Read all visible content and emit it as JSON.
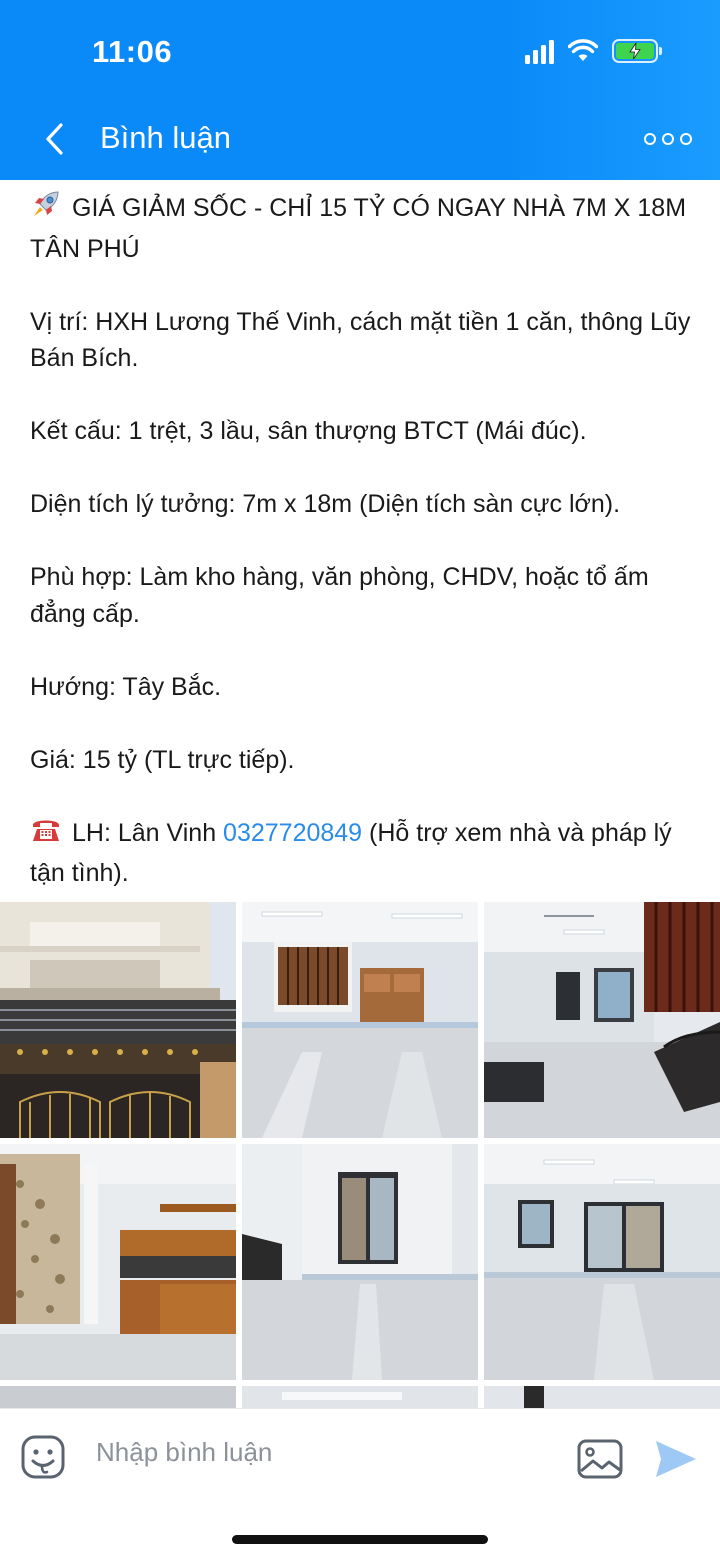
{
  "status_bar": {
    "time": "11:06"
  },
  "header": {
    "title": "Bình luận",
    "back_icon": "chevron-left-icon",
    "more_icon": "more-icon"
  },
  "post": {
    "headline": "GIÁ GIẢM SỐC - CHỈ 15 TỶ CÓ NGAY NHÀ 7M X 18M TÂN PHÚ",
    "headline_emoji": "rocket-icon",
    "location": "Vị trí: HXH Lương Thế Vinh, cách mặt tiền 1 căn, thông Lũy Bán Bích.",
    "structure": "Kết cấu: 1 trệt, 3 lầu, sân thượng BTCT (Mái đúc).",
    "area": "Diện tích lý tưởng: 7m x 18m (Diện tích sàn cực lớn).",
    "suitable": "Phù hợp: Làm kho hàng, văn phòng, CHDV, hoặc tổ ấm đẳng cấp.",
    "direction": "Hướng: Tây Bắc.",
    "price": "Giá: 15 tỷ (TL trực tiếp).",
    "contact_prefix": "LH: Lân Vinh ",
    "contact_phone": "0327720849",
    "contact_suffix": " (Hỗ trợ xem nhà và pháp lý tận tình).",
    "contact_emoji": "telephone-icon"
  },
  "photos": [
    "house-facade-photo",
    "ground-floor-stairs-photo",
    "hall-stairs-photo",
    "kitchen-cabinet-photo",
    "room-door-photo",
    "room-windows-photo"
  ],
  "comment_bar": {
    "placeholder": "Nhập bình luận",
    "emoji_icon": "smiley-icon",
    "image_icon": "image-icon",
    "send_icon": "send-icon"
  },
  "colors": {
    "header": "#0a8af8",
    "link": "#2a8ce8",
    "send": "#9ec9f4"
  }
}
